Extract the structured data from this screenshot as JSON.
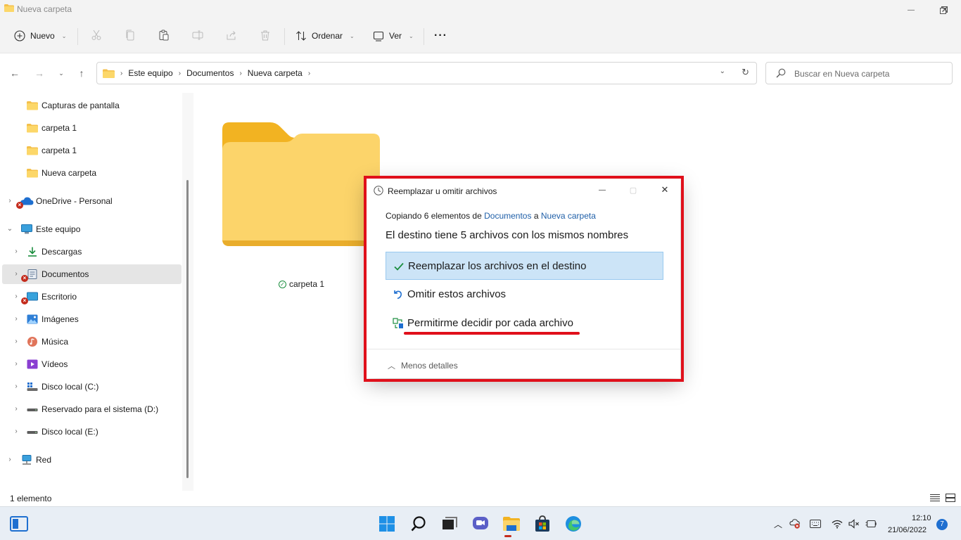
{
  "window": {
    "title": "Nueva carpeta",
    "minimize": "—",
    "maximize": "▢",
    "close": "✕"
  },
  "toolbar": {
    "new_label": "Nuevo",
    "sort_label": "Ordenar",
    "view_label": "Ver",
    "more_label": "···"
  },
  "address": {
    "crumbs": [
      "Este equipo",
      "Documentos",
      "Nueva carpeta"
    ],
    "search_placeholder": "Buscar en Nueva carpeta"
  },
  "sidebar": {
    "items": [
      {
        "label": "Capturas de pantalla"
      },
      {
        "label": "carpeta 1"
      },
      {
        "label": "carpeta 1"
      },
      {
        "label": "Nueva carpeta"
      },
      {
        "label": "OneDrive - Personal"
      },
      {
        "label": "Este equipo"
      },
      {
        "label": "Descargas"
      },
      {
        "label": "Documentos"
      },
      {
        "label": "Escritorio"
      },
      {
        "label": "Imágenes"
      },
      {
        "label": "Música"
      },
      {
        "label": "Vídeos"
      },
      {
        "label": "Disco local (C:)"
      },
      {
        "label": "Reservado para el sistema (D:)"
      },
      {
        "label": "Disco local (E:)"
      },
      {
        "label": "Red"
      }
    ]
  },
  "content": {
    "folder_name": "carpeta 1"
  },
  "status": {
    "item_count": "1 elemento"
  },
  "dialog": {
    "title": "Reemplazar u omitir archivos",
    "copy_prefix": "Copiando 6 elementos de",
    "copy_source": "Documentos",
    "copy_mid": "a",
    "copy_dest": "Nueva carpeta",
    "heading": "El destino tiene 5 archivos con los mismos nombres",
    "option_replace": "Reemplazar los archivos en el destino",
    "option_skip": "Omitir estos archivos",
    "option_decide": "Permitirme decidir por cada archivo",
    "less_details": "Menos detalles"
  },
  "taskbar": {
    "time": "12:10",
    "date": "21/06/2022",
    "notifications": "7"
  },
  "colors": {
    "highlight_red": "#e0101b",
    "selection_blue": "#cce4f7",
    "link_blue": "#1f5fa8",
    "folder_yellow": "#f7c948"
  }
}
